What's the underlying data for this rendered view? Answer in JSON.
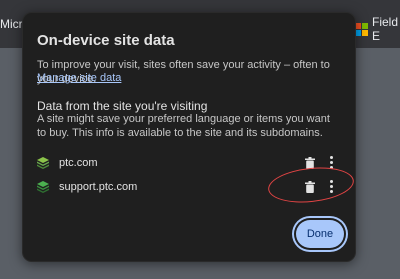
{
  "bookmarks": {
    "left_label": "Micros",
    "right_label": "Field E"
  },
  "dialog": {
    "title": "On-device site data",
    "description": "To improve your visit, sites often save your activity – often to your device.",
    "manage_link": "Manage site data",
    "section_heading": "Data from the site you're visiting",
    "section_description": "A site might save your preferred language or items you want to buy. This info is available to the site and its subdomains.",
    "sites": [
      {
        "name": "ptc.com",
        "icon": "ptc-favicon"
      },
      {
        "name": "support.ptc.com",
        "icon": "ptc-support-favicon"
      }
    ],
    "done_label": "Done"
  },
  "colors": {
    "dialog_bg": "#1f1f1f",
    "link": "#a8c7fa",
    "primary_button": "#a8c7fa",
    "annotation": "#e04444"
  }
}
